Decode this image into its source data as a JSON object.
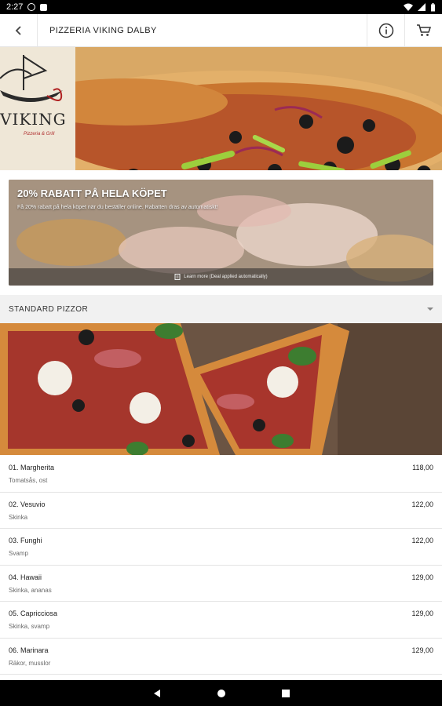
{
  "status_bar": {
    "time": "2:27"
  },
  "app_bar": {
    "title": "PIZZERIA VIKING DALBY"
  },
  "hero": {
    "logo_text": "VIKING",
    "logo_sub": "Pizzeria & Grill"
  },
  "promo": {
    "title": "20% RABATT PÅ HELA KÖPET",
    "description": "Få 20% rabatt på hela köpet när du beställer online. Rabatten dras av automatiskt!",
    "footer": "Learn more (Deal applied automatically)"
  },
  "category": {
    "title": "STANDARD PIZZOR"
  },
  "menu_items": [
    {
      "name": "01. Margherita",
      "desc": "Tomatsås, ost",
      "price": "118,00"
    },
    {
      "name": "02. Vesuvio",
      "desc": "Skinka",
      "price": "122,00"
    },
    {
      "name": "03. Funghi",
      "desc": "Svamp",
      "price": "122,00"
    },
    {
      "name": "04. Hawaii",
      "desc": "Skinka, ananas",
      "price": "129,00"
    },
    {
      "name": "05. Capricciosa",
      "desc": "Skinka, svamp",
      "price": "129,00"
    },
    {
      "name": "06. Marinara",
      "desc": "Räkor, musslor",
      "price": "129,00"
    }
  ],
  "icons": {
    "back": "back-arrow-icon",
    "info": "info-icon",
    "cart": "cart-icon",
    "chevron": "chevron-down-icon",
    "nav_back": "nav-back-icon",
    "nav_home": "nav-home-icon",
    "nav_recents": "nav-recents-icon"
  },
  "colors": {
    "status_bar": "#000000",
    "app_bar": "#ffffff",
    "category_header": "#f1f1f1",
    "price_text": "#222222"
  }
}
